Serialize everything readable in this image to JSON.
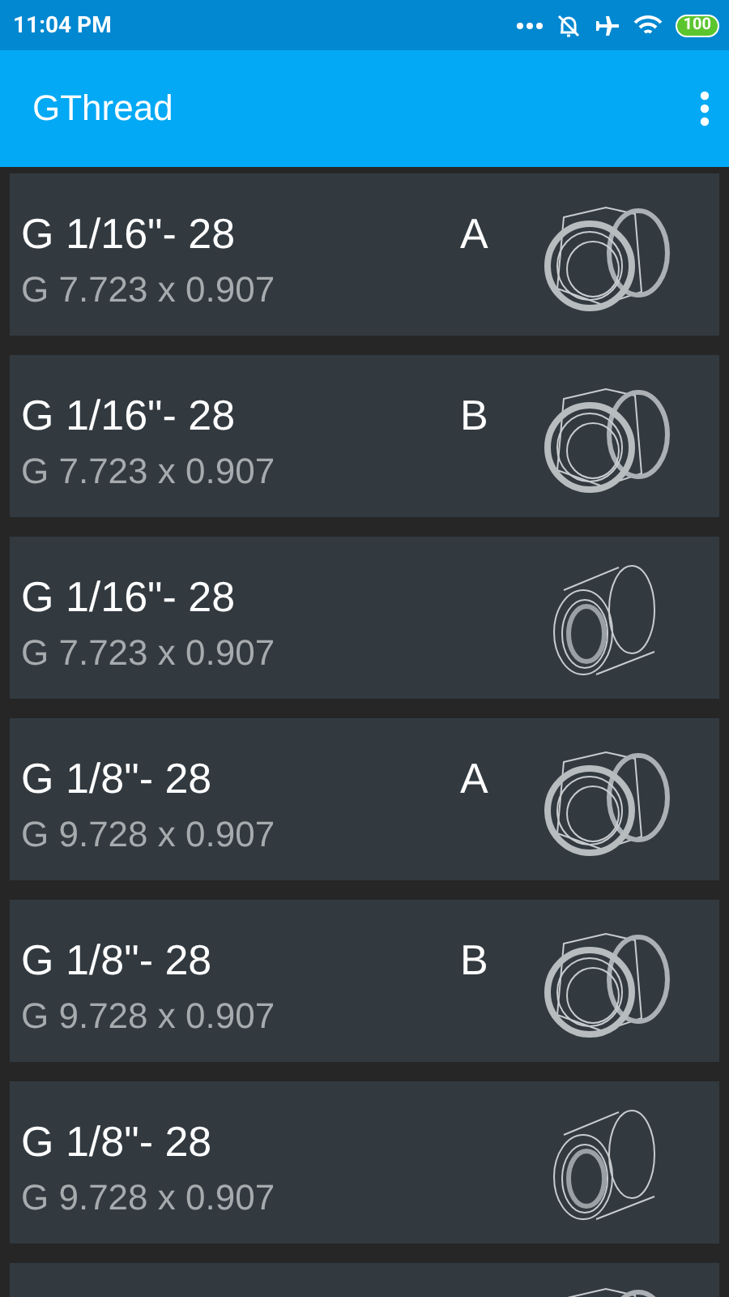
{
  "status_bar": {
    "time": "11:04 PM",
    "battery": "100"
  },
  "app_bar": {
    "title": "GThread"
  },
  "threads": [
    {
      "title": "G 1/16\"- 28",
      "size": "G 7.723 x 0.907",
      "variant": "A",
      "kind": "male"
    },
    {
      "title": "G 1/16\"- 28",
      "size": "G 7.723 x 0.907",
      "variant": "B",
      "kind": "male"
    },
    {
      "title": "G 1/16\"- 28",
      "size": "G 7.723 x 0.907",
      "kind": "female"
    },
    {
      "title": "G 1/8\"- 28",
      "size": "G 9.728 x 0.907",
      "variant": "A",
      "kind": "male"
    },
    {
      "title": "G 1/8\"- 28",
      "size": "G 9.728 x 0.907",
      "variant": "B",
      "kind": "male"
    },
    {
      "title": "G 1/8\"- 28",
      "size": "G 9.728 x 0.907",
      "kind": "female"
    },
    {
      "kind": "male"
    }
  ]
}
